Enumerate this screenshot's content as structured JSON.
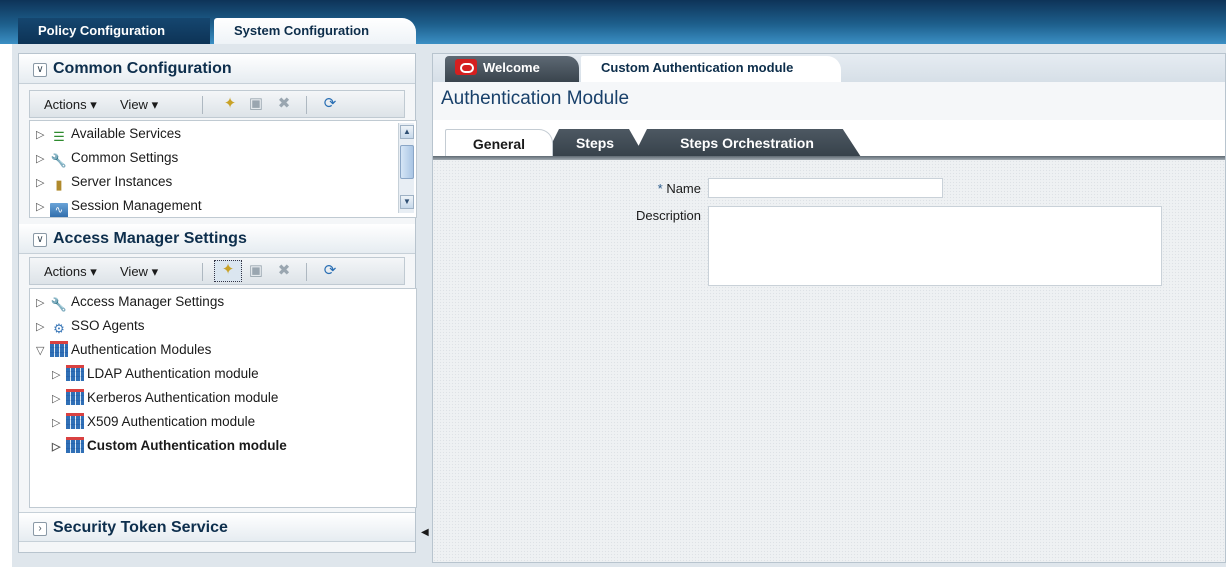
{
  "top_tabs": {
    "policy": "Policy Configuration",
    "system": "System Configuration"
  },
  "left": {
    "common": {
      "title": "Common Configuration",
      "actions_label": "Actions",
      "view_label": "View",
      "items": [
        "Available Services",
        "Common Settings",
        "Server Instances",
        "Session Management"
      ]
    },
    "access": {
      "title": "Access Manager Settings",
      "actions_label": "Actions",
      "view_label": "View",
      "items": [
        "Access Manager Settings",
        "SSO Agents",
        "Authentication Modules",
        "LDAP Authentication module",
        "Kerberos Authentication module",
        "X509 Authentication module",
        "Custom Authentication module"
      ]
    },
    "sts": {
      "title": "Security Token Service"
    }
  },
  "right": {
    "doc_tabs": {
      "welcome": "Welcome",
      "custom": "Custom Authentication module"
    },
    "title": "Authentication Module",
    "inner_tabs": {
      "general": "General",
      "steps": "Steps",
      "orchestration": "Steps Orchestration"
    },
    "form": {
      "name_required_mark": "*",
      "name_label": "Name",
      "name_value": "",
      "description_label": "Description",
      "description_value": ""
    }
  },
  "icons": {
    "expand_collapsed": "triangle-right",
    "expand_open": "triangle-down",
    "create": "create-icon",
    "folder": "folder-icon",
    "delete": "delete-icon",
    "refresh": "refresh-icon",
    "splitter": "collapse-left"
  },
  "colors": {
    "accent": "#18406a",
    "header_dark": "#0e3358",
    "tab_dark": "#3a444d",
    "oracle_red": "#d51f1f"
  }
}
